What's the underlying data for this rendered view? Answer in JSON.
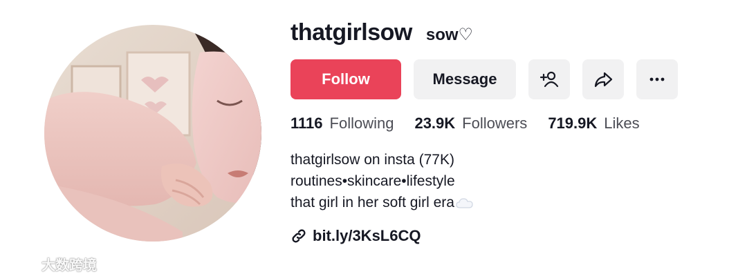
{
  "profile": {
    "username": "thatgirlsow",
    "nickname": "sow♡"
  },
  "actions": {
    "follow_label": "Follow",
    "message_label": "Message",
    "icons": [
      "add-friend-icon",
      "share-icon",
      "more-icon"
    ]
  },
  "stats": [
    {
      "value": "1116",
      "label": "Following"
    },
    {
      "value": "23.9K",
      "label": "Followers"
    },
    {
      "value": "719.9K",
      "label": "Likes"
    }
  ],
  "bio": {
    "lines": [
      "thatgirlsow on insta (77K)",
      "routines•skincare•lifestyle",
      "that girl in her soft girl era"
    ],
    "trailing_icon": "cloud-emoji"
  },
  "link": {
    "text": "bit.ly/3KsL6CQ",
    "icon": "link-icon"
  },
  "watermark": {
    "text": "大数跨境"
  },
  "colors": {
    "follow_bg": "#ea4359",
    "button_bg": "#f1f1f2",
    "text_primary": "#161823",
    "text_secondary": "#4c4d55"
  }
}
